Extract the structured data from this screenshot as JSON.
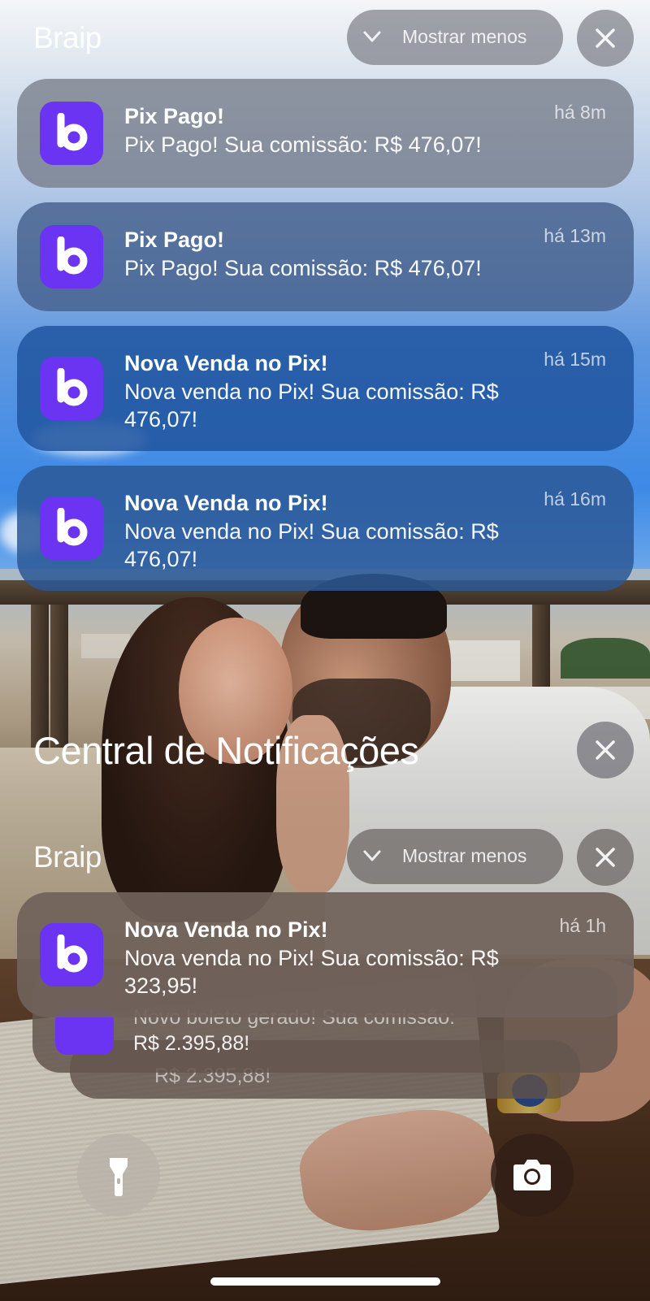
{
  "colors": {
    "app_icon": "#6b34f2",
    "pill_bg": "#78787f",
    "home_indicator": "#ffffff"
  },
  "top_group": {
    "app_name": "Braip",
    "toggle_label": "Mostrar menos",
    "toggle_icon": "chevron-down-icon",
    "close_icon": "close-icon",
    "notifications": [
      {
        "title": "Pix Pago!",
        "body": "Pix Pago! Sua comissão: R$ 476,07!",
        "time": "há 8m",
        "icon": "braip-b-icon"
      },
      {
        "title": "Pix Pago!",
        "body": "Pix Pago! Sua comissão: R$ 476,07!",
        "time": "há 13m",
        "icon": "braip-b-icon"
      },
      {
        "title": "Nova Venda no Pix!",
        "body": "Nova venda no Pix! Sua comissão: R$ 476,07!",
        "time": "há 15m",
        "icon": "braip-b-icon"
      },
      {
        "title": "Nova Venda no Pix!",
        "body": "Nova venda no Pix! Sua comissão: R$ 476,07!",
        "time": "há 16m",
        "icon": "braip-b-icon"
      }
    ]
  },
  "notification_center": {
    "title": "Central de Notificações",
    "close_icon": "close-icon"
  },
  "bottom_group": {
    "app_name": "Braip",
    "toggle_label": "Mostrar menos",
    "front": {
      "title": "Nova Venda no Pix!",
      "body": "Nova venda no Pix! Sua comissão: R$ 323,95!",
      "time": "há 1h"
    },
    "stacked_1": {
      "line1": "Novo boleto gerado! Sua comissão:",
      "line2": "R$ 2.395,88!"
    },
    "stacked_2": {
      "line1": "R$ 2.395,88!"
    }
  },
  "lock_actions": {
    "flashlight_icon": "flashlight-icon",
    "camera_icon": "camera-icon"
  }
}
